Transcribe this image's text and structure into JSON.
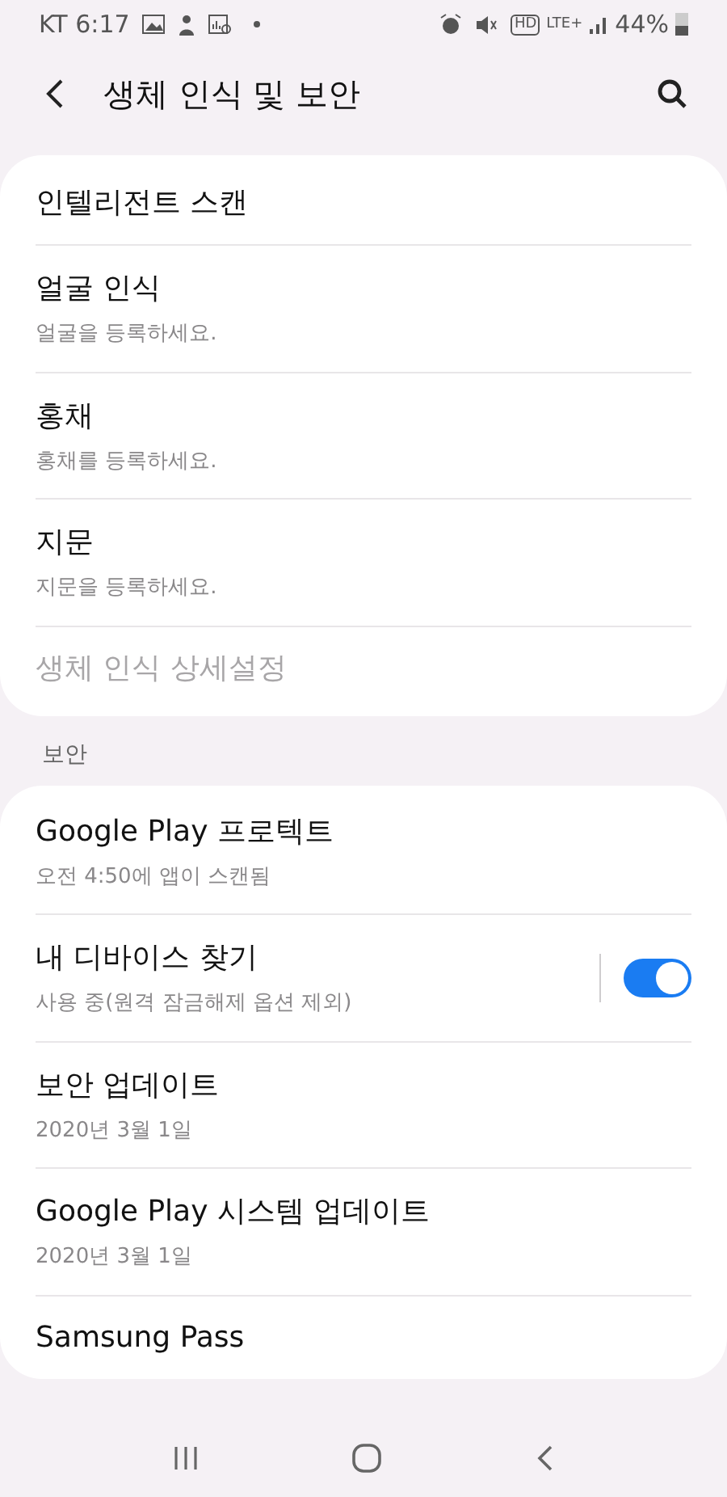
{
  "status_bar": {
    "carrier_time": "KT 6:17",
    "network_labels": [
      "HD",
      "LTE+"
    ],
    "battery_text": "44%"
  },
  "header": {
    "title": "생체 인식 및 보안"
  },
  "biometrics": {
    "items": [
      {
        "kind": "plain",
        "title": "인텔리전트 스캔"
      },
      {
        "kind": "detail",
        "title": "얼굴 인식",
        "subtitle": "얼굴을 등록하세요."
      },
      {
        "kind": "detail",
        "title": "홍채",
        "subtitle": "홍채를 등록하세요."
      },
      {
        "kind": "detail",
        "title": "지문",
        "subtitle": "지문을 등록하세요."
      },
      {
        "kind": "disabled",
        "title": "생체 인식 상세설정"
      }
    ]
  },
  "security": {
    "header": "보안",
    "items": [
      {
        "kind": "detail",
        "title": "Google Play 프로텍트",
        "subtitle": "오전 4:50에 앱이 스캔됨"
      },
      {
        "kind": "toggle",
        "title": "내 디바이스 찾기",
        "subtitle": "사용 중(원격 잠금해제 옵션 제외)",
        "on": true
      },
      {
        "kind": "detail",
        "title": "보안 업데이트",
        "subtitle": "2020년 3월 1일"
      },
      {
        "kind": "detail",
        "title": "Google Play 시스템 업데이트",
        "subtitle": "2020년 3월 1일"
      },
      {
        "kind": "plain",
        "title": "Samsung Pass"
      }
    ]
  }
}
